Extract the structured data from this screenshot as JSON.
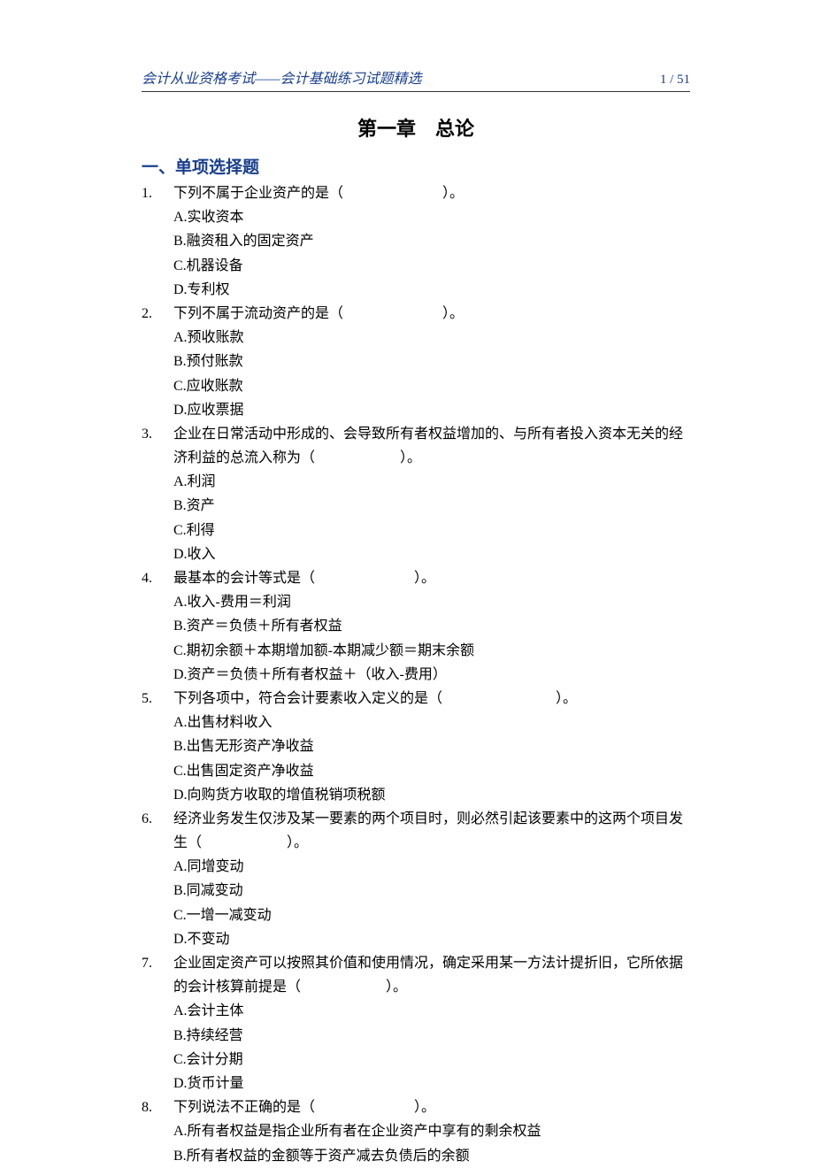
{
  "header": {
    "title": "会计从业资格考试——会计基础练习试题精选",
    "page_current": "1",
    "page_sep": " / ",
    "page_total": "51"
  },
  "chapter_title": "第一章 总论",
  "section_title": "一、单项选择题",
  "questions": [
    {
      "num": "1.",
      "stem": "下列不属于企业资产的是（　　　　　　　）。",
      "options": [
        "A.实收资本",
        "B.融资租入的固定资产",
        "C.机器设备",
        "D.专利权"
      ]
    },
    {
      "num": "2.",
      "stem": "下列不属于流动资产的是（　　　　　　　）。",
      "options": [
        "A.预收账款",
        "B.预付账款",
        "C.应收账款",
        "D.应收票据"
      ]
    },
    {
      "num": "3.",
      "stem": "企业在日常活动中形成的、会导致所有者权益增加的、与所有者投入资本无关的经济利益的总流入称为（　　　　　　）。",
      "options": [
        "A.利润",
        "B.资产",
        "C.利得",
        "D.收入"
      ]
    },
    {
      "num": "4.",
      "stem": "最基本的会计等式是（　　　　　　　）。",
      "options": [
        "A.收入-费用＝利润",
        "B.资产＝负债＋所有者权益",
        "C.期初余额＋本期增加额-本期减少额＝期末余额",
        "D.资产＝负债＋所有者权益＋（收入-费用）"
      ]
    },
    {
      "num": "5.",
      "stem": "下列各项中，符合会计要素收入定义的是（　　　　　　　　）。",
      "options": [
        "A.出售材料收入",
        "B.出售无形资产净收益",
        "C.出售固定资产净收益",
        "D.向购货方收取的增值税销项税额"
      ]
    },
    {
      "num": "6.",
      "stem": "经济业务发生仅涉及某一要素的两个项目时，则必然引起该要素中的这两个项目发生（　　　　　　）。",
      "options": [
        "A.同增变动",
        "B.同减变动",
        "C.一增一减变动",
        "D.不变动"
      ]
    },
    {
      "num": "7.",
      "stem": "企业固定资产可以按照其价值和使用情况，确定采用某一方法计提折旧，它所依据的会计核算前提是（　　　　　　）。",
      "options": [
        "A.会计主体",
        "B.持续经营",
        "C.会计分期",
        "D.货币计量"
      ]
    },
    {
      "num": "8.",
      "stem": "下列说法不正确的是（　　　　　　　）。",
      "options": [
        "A.所有者权益是指企业所有者在企业资产中享有的剩余权益",
        "B.所有者权益的金额等于资产减去负债后的余额"
      ]
    }
  ]
}
